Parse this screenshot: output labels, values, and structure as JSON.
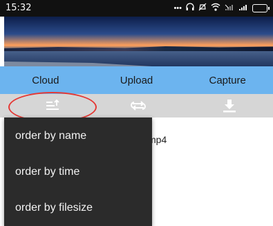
{
  "status_bar": {
    "time": "15:32",
    "icons": [
      "more-dots-icon",
      "headset-icon",
      "mute-icon",
      "wifi-icon",
      "no-signal-icon",
      "signal-icon",
      "battery-icon"
    ]
  },
  "tabs": [
    {
      "label": "Cloud"
    },
    {
      "label": "Upload"
    },
    {
      "label": "Capture"
    }
  ],
  "toolbar": {
    "icons": [
      "sort-icon",
      "repeat-icon",
      "download-icon"
    ]
  },
  "content": {
    "file_fragment": "mp4"
  },
  "sort_menu": {
    "items": [
      {
        "label": "order by name"
      },
      {
        "label": "order by time"
      },
      {
        "label": "order by filesize"
      }
    ]
  },
  "colors": {
    "tab_bar": "#6cb4ef",
    "toolbar": "#d6d6d6",
    "menu_bg": "#2b2b2b",
    "highlight": "#e53935"
  }
}
